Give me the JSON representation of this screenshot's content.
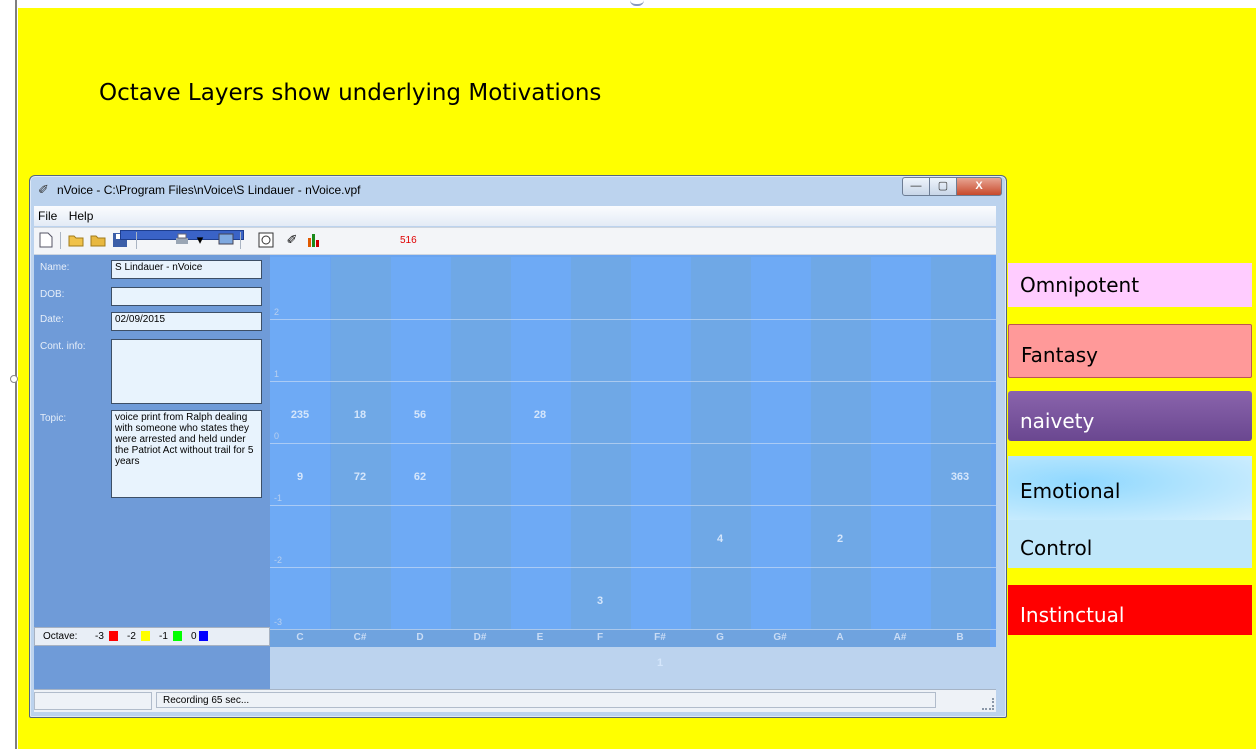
{
  "slide": {
    "title": "Octave Layers show underlying  Motivations"
  },
  "window": {
    "title": "nVoice - C:\\Program Files\\nVoice\\S Lindauer - nVoice.vpf",
    "buttons": {
      "minimize": "—",
      "maximize": "▢",
      "close": "X"
    }
  },
  "menu": [
    {
      "label": "File"
    },
    {
      "label": "Help"
    }
  ],
  "toolbar": {
    "icons": [
      "new-file-icon",
      "open-folder-icon",
      "save-icon",
      "print-icon",
      "monitor-icon",
      "voice-icon",
      "microphone-icon",
      "bar-chart-icon"
    ],
    "count": "516"
  },
  "form": {
    "name_label": "Name:",
    "name_value": "S Lindauer - nVoice",
    "dob_label": "DOB:",
    "dob_value": "",
    "date_label": "Date:",
    "date_value": "02/09/2015",
    "contact_label": "Cont. info:",
    "contact_value": "",
    "topic_label": "Topic:",
    "topic_value": "voice print from Ralph dealing with someone who states they were arrested and held under the Patriot Act without trail for 5 years"
  },
  "octave_legend": {
    "label": "Octave:",
    "items": [
      {
        "label": "-3",
        "color": "#ff0000"
      },
      {
        "label": "-2",
        "color": "#ffff00"
      },
      {
        "label": "-1",
        "color": "#00ff00"
      },
      {
        "label": "0",
        "color": "#0000ff"
      }
    ]
  },
  "grid": {
    "octave_labels": [
      "2",
      "1",
      "0",
      "-1",
      "-2",
      "-3"
    ],
    "notes": [
      "C",
      "C#",
      "D",
      "D#",
      "E",
      "F",
      "F#",
      "G",
      "G#",
      "A",
      "A#",
      "B"
    ],
    "values": [
      {
        "note": "C",
        "octave": "1",
        "value": "235"
      },
      {
        "note": "C#",
        "octave": "1",
        "value": "18"
      },
      {
        "note": "D",
        "octave": "1",
        "value": "56"
      },
      {
        "note": "E",
        "octave": "1",
        "value": "28"
      },
      {
        "note": "C",
        "octave": "0",
        "value": "9"
      },
      {
        "note": "C#",
        "octave": "0",
        "value": "72"
      },
      {
        "note": "D",
        "octave": "0",
        "value": "62"
      },
      {
        "note": "B",
        "octave": "0",
        "value": "363"
      },
      {
        "note": "G",
        "octave": "-1",
        "value": "4"
      },
      {
        "note": "A",
        "octave": "-1",
        "value": "2"
      },
      {
        "note": "F",
        "octave": "-2",
        "value": "3"
      },
      {
        "note": "F#",
        "octave": "-3",
        "value": "1"
      }
    ]
  },
  "status": {
    "text": "Recording 65 sec..."
  },
  "categories": [
    {
      "label": "Omnipotent",
      "bg": "#ffccff",
      "fg": "#000000"
    },
    {
      "label": "Fantasy",
      "bg": "#ff9999",
      "fg": "#000000"
    },
    {
      "label": "naivety",
      "bg": "#7b559c",
      "fg": "#ffffff"
    },
    {
      "label": "Emotional",
      "bg": "#aee3fb",
      "fg": "#000000"
    },
    {
      "label": "Control",
      "bg": "#bfe7fa",
      "fg": "#000000"
    },
    {
      "label": "Instinctual",
      "bg": "#ff0000",
      "fg": "#ffffff"
    }
  ]
}
